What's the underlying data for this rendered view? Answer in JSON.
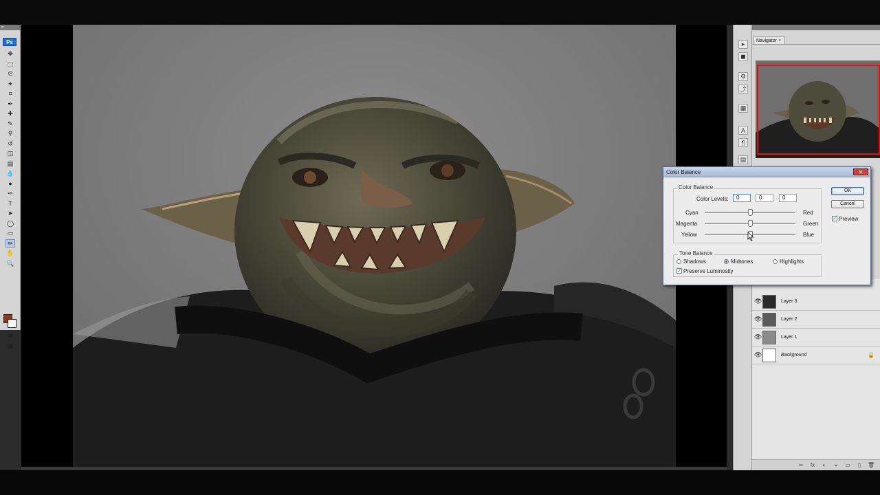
{
  "app": {
    "logo": "Ps"
  },
  "toolbox": {
    "grip": "»",
    "tools": [
      {
        "name": "move-tool",
        "glyph": "✥"
      },
      {
        "name": "marquee-tool",
        "glyph": "⬚"
      },
      {
        "name": "lasso-tool",
        "glyph": "ᘓ"
      },
      {
        "name": "magic-wand-tool",
        "glyph": "✦"
      },
      {
        "name": "crop-tool",
        "glyph": "⌗"
      },
      {
        "name": "eyedropper-tool",
        "glyph": "✒"
      },
      {
        "name": "healing-brush-tool",
        "glyph": "✚"
      },
      {
        "name": "brush-tool",
        "glyph": "✎"
      },
      {
        "name": "clone-stamp-tool",
        "glyph": "⚲"
      },
      {
        "name": "history-brush-tool",
        "glyph": "↺"
      },
      {
        "name": "eraser-tool",
        "glyph": "◫"
      },
      {
        "name": "gradient-tool",
        "glyph": "▤"
      },
      {
        "name": "blur-tool",
        "glyph": "💧"
      },
      {
        "name": "dodge-tool",
        "glyph": "●"
      },
      {
        "name": "pen-tool",
        "glyph": "✑"
      },
      {
        "name": "type-tool",
        "glyph": "T"
      },
      {
        "name": "path-selection-tool",
        "glyph": "➤"
      },
      {
        "name": "shape-tool",
        "glyph": "◯"
      },
      {
        "name": "notes-tool",
        "glyph": "▭"
      },
      {
        "name": "eyedropper-active-tool",
        "glyph": "✏"
      },
      {
        "name": "hand-tool",
        "glyph": "✋"
      },
      {
        "name": "zoom-tool",
        "glyph": "🔍"
      }
    ],
    "quick_mask_glyph": "◙",
    "screen_mode_glyph": "▣",
    "foreground_color": "#8b3a1f",
    "background_color": "#ffffff"
  },
  "dock": {
    "icons": [
      "▸",
      "◼",
      "⚙",
      "⤴",
      "▦",
      "A",
      "¶",
      "▤"
    ]
  },
  "navigator": {
    "tab_label": "Navigator",
    "close_glyph": "×",
    "view_box_color": "#e01010"
  },
  "dialog": {
    "title": "Color Balance",
    "close_glyph": "✕",
    "color_balance_group": "Color Balance",
    "color_levels_label": "Color Levels:",
    "levels": [
      "0",
      "0",
      "0"
    ],
    "sliders": [
      {
        "left": "Cyan",
        "right": "Red",
        "value": 0
      },
      {
        "left": "Magenta",
        "right": "Green",
        "value": 0
      },
      {
        "left": "Yellow",
        "right": "Blue",
        "value": 0
      }
    ],
    "tone_balance_group": "Tone Balance",
    "tones": [
      {
        "label": "Shadows",
        "selected": false
      },
      {
        "label": "Midtones",
        "selected": true
      },
      {
        "label": "Highlights",
        "selected": false
      }
    ],
    "preserve_luminosity_label": "Preserve Luminosity",
    "preserve_luminosity_checked": true,
    "ok_label": "OK",
    "cancel_label": "Cancel",
    "preview_label": "Preview",
    "preview_checked": true
  },
  "layers": [
    {
      "name": "Layer 3",
      "visible": true,
      "thumb": "#2a2a2a",
      "locked": false
    },
    {
      "name": "Layer 2",
      "visible": true,
      "thumb": "#5a5a5a",
      "locked": false
    },
    {
      "name": "Layer 1",
      "visible": true,
      "thumb": "#8a8a8a",
      "locked": false
    },
    {
      "name": "Background",
      "visible": true,
      "thumb": "#ffffff",
      "locked": true
    }
  ],
  "layers_footer_icons": [
    "∞",
    "fx",
    "◐",
    "◒",
    "▭",
    "▯",
    "🗑"
  ]
}
